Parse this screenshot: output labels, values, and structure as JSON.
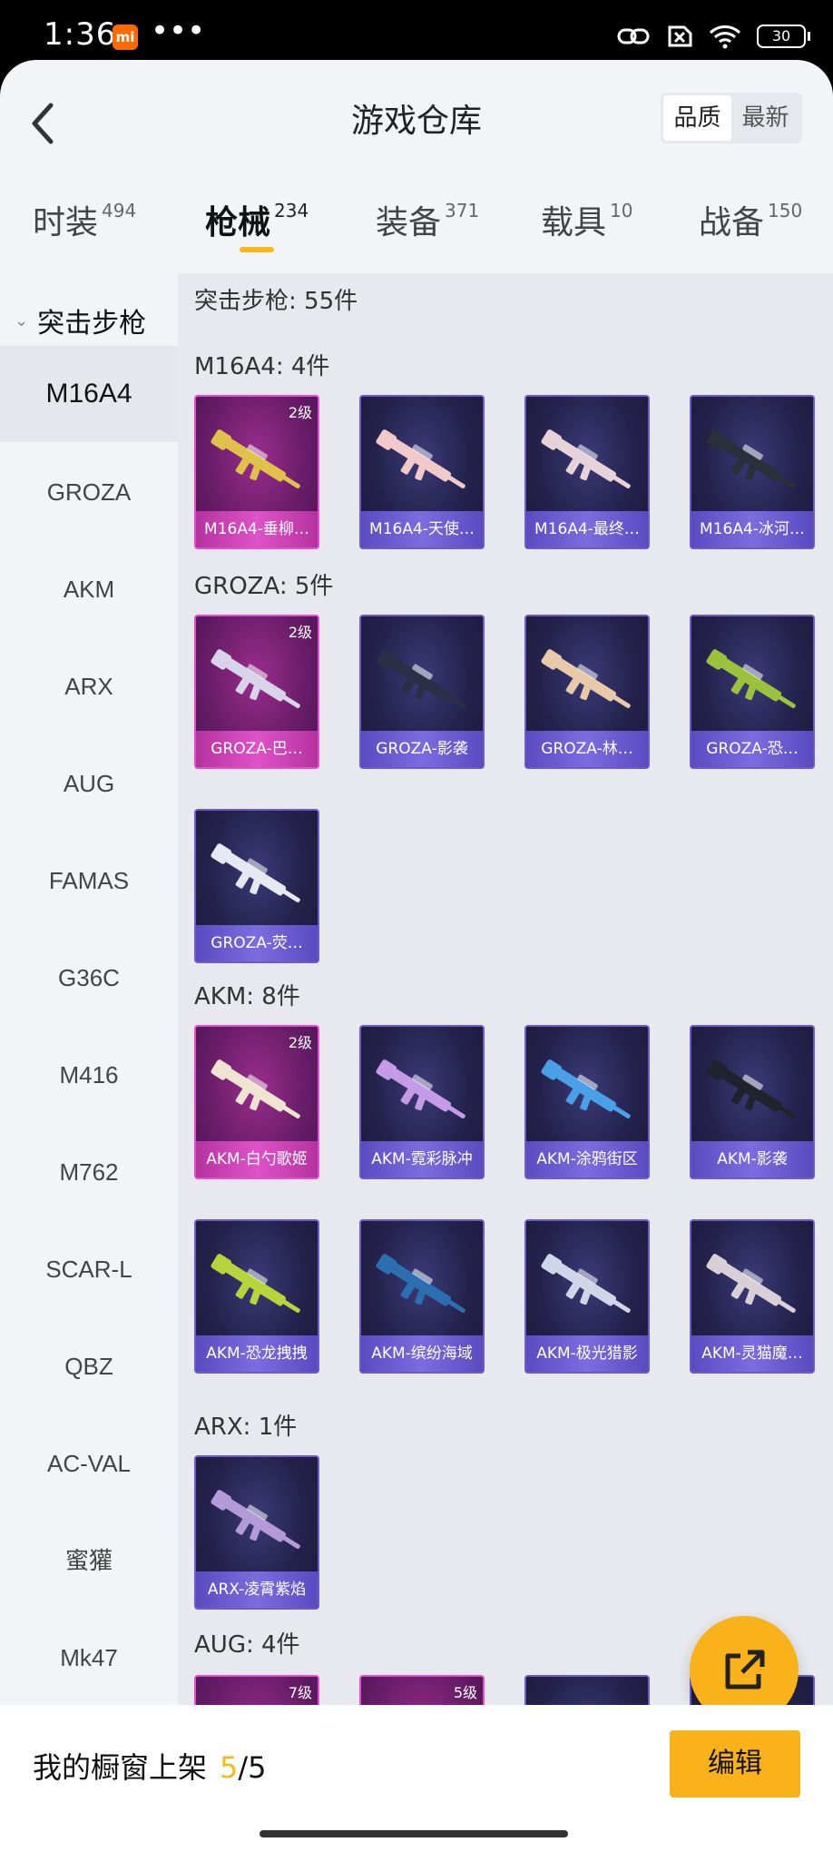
{
  "status": {
    "time": "1:36",
    "battery": "30",
    "mi_badge": "mi",
    "dots": "•••"
  },
  "header": {
    "title": "游戏仓库",
    "sort": [
      "品质",
      "最新"
    ],
    "sort_active": 0
  },
  "tabs": [
    {
      "label": "时装",
      "count": "494"
    },
    {
      "label": "枪械",
      "count": "234",
      "active": true
    },
    {
      "label": "装备",
      "count": "371"
    },
    {
      "label": "载具",
      "count": "10"
    },
    {
      "label": "战备",
      "count": "150"
    }
  ],
  "sidebar": {
    "group": "突击步枪",
    "items": [
      "M16A4",
      "GROZA",
      "AKM",
      "ARX",
      "AUG",
      "FAMAS",
      "G36C",
      "M416",
      "M762",
      "SCAR-L",
      "QBZ",
      "AC-VAL",
      "蜜獾",
      "Mk47"
    ],
    "active": 0
  },
  "content": {
    "summary": "突击步枪: 55件",
    "sections": [
      {
        "header": "M16A4: 4件",
        "items": [
          {
            "name": "M16A4-垂柳…",
            "grade": "2级",
            "tier": "pink",
            "color": "#e0c24a"
          },
          {
            "name": "M16A4-天使…",
            "grade": "",
            "tier": "purple",
            "color": "#f1c9c9"
          },
          {
            "name": "M16A4-最终…",
            "grade": "",
            "tier": "purple",
            "color": "#e6d2d8"
          },
          {
            "name": "M16A4-冰河…",
            "grade": "",
            "tier": "purple",
            "color": "#2a2f3a"
          }
        ]
      },
      {
        "header": "GROZA: 5件",
        "items": [
          {
            "name": "GROZA-巴…",
            "grade": "2级",
            "tier": "pink",
            "color": "#d7d3e8"
          },
          {
            "name": "GROZA-影袭",
            "grade": "",
            "tier": "purple",
            "color": "#2b2f45"
          },
          {
            "name": "GROZA-林…",
            "grade": "",
            "tier": "purple",
            "color": "#e8c9a8"
          },
          {
            "name": "GROZA-恐…",
            "grade": "",
            "tier": "purple",
            "color": "#9bc23c"
          },
          {
            "name": "GROZA-荧…",
            "grade": "",
            "tier": "purple",
            "color": "#e6e8f2"
          }
        ]
      },
      {
        "header": "AKM: 8件",
        "items": [
          {
            "name": "AKM-白勺歌姬",
            "grade": "2级",
            "tier": "pink",
            "color": "#efe4cf"
          },
          {
            "name": "AKM-霓彩脉冲",
            "grade": "",
            "tier": "purple",
            "color": "#c59be8"
          },
          {
            "name": "AKM-涂鸦街区",
            "grade": "",
            "tier": "purple",
            "color": "#4aa0e6"
          },
          {
            "name": "AKM-影袭",
            "grade": "",
            "tier": "purple",
            "color": "#20232e"
          },
          {
            "name": "AKM-恐龙拽拽",
            "grade": "",
            "tier": "purple",
            "color": "#b7d43a"
          },
          {
            "name": "AKM-缤纷海域",
            "grade": "",
            "tier": "purple",
            "color": "#2b6fb0"
          },
          {
            "name": "AKM-极光猎影",
            "grade": "",
            "tier": "purple",
            "color": "#cfd6e8"
          },
          {
            "name": "AKM-灵猫魔…",
            "grade": "",
            "tier": "purple",
            "color": "#d8d0d6"
          }
        ]
      },
      {
        "header": "ARX: 1件",
        "items": [
          {
            "name": "ARX-凌霄紫焰",
            "grade": "",
            "tier": "purple",
            "color": "#b39ad8"
          }
        ]
      },
      {
        "header": "AUG: 4件",
        "items": [
          {
            "name": "",
            "grade": "7级",
            "tier": "pink",
            "color": "#56b0e8"
          },
          {
            "name": "",
            "grade": "5级",
            "tier": "pink",
            "color": "#e8b08a"
          },
          {
            "name": "",
            "grade": "",
            "tier": "purple",
            "color": "#e0d2c8"
          },
          {
            "name": "",
            "grade": "",
            "tier": "purple",
            "color": "#c8ccd8"
          }
        ]
      }
    ]
  },
  "bottom": {
    "label": "我的橱窗上架",
    "current": "5",
    "sep_total": "/5",
    "edit": "编辑"
  }
}
